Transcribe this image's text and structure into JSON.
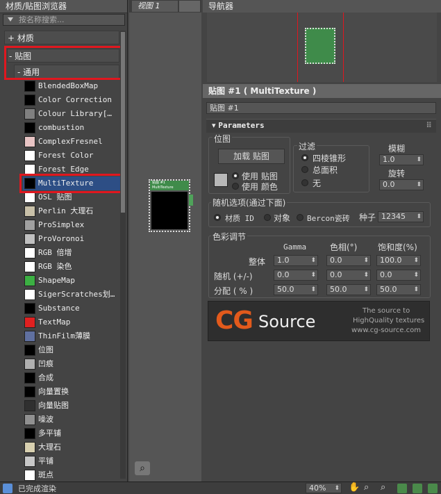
{
  "browser": {
    "title": "材质/贴图浏览器",
    "search_placeholder": "按名称搜索...",
    "groups": {
      "materials": "+ 材质",
      "maps": "- 贴图",
      "general": "- 通用"
    },
    "items": [
      {
        "label": "BlendedBoxMap",
        "swatch": "#000000"
      },
      {
        "label": "Color Correction",
        "swatch": "#000000"
      },
      {
        "label": "Colour Library[…",
        "swatch": "#808080"
      },
      {
        "label": "combustion",
        "swatch": "#000000"
      },
      {
        "label": "ComplexFresnel",
        "swatch": "#e8c4c4"
      },
      {
        "label": "Forest Color",
        "swatch": "#ffffff"
      },
      {
        "label": "Forest Edge",
        "swatch": "#ffffff"
      },
      {
        "label": "MultiTexture",
        "swatch": "#000000"
      },
      {
        "label": "OSL 贴图",
        "swatch": "#ffffff"
      },
      {
        "label": "Perlin 大理石",
        "swatch": "#c8c0a8"
      },
      {
        "label": "ProSimplex",
        "swatch": "#a0a0a0"
      },
      {
        "label": "ProVoronoi",
        "swatch": "#c0c0c0"
      },
      {
        "label": "RGB 倍增",
        "swatch": "#ffffff"
      },
      {
        "label": "RGB 染色",
        "swatch": "#ffffff"
      },
      {
        "label": "ShapeMap",
        "swatch": "#3cb043"
      },
      {
        "label": "SigerScratches划…",
        "swatch": "#ffffff"
      },
      {
        "label": "Substance",
        "swatch": "#000000"
      },
      {
        "label": "TextMap",
        "swatch": "#e02020"
      },
      {
        "label": "ThinFilm薄膜",
        "swatch": "#6070a0"
      },
      {
        "label": "位图",
        "swatch": "#000000"
      },
      {
        "label": "凹痕",
        "swatch": "#b0b0b0"
      },
      {
        "label": "合成",
        "swatch": "#000000"
      },
      {
        "label": "向量置换",
        "swatch": "#000000"
      },
      {
        "label": "向量贴图",
        "swatch": "#303030"
      },
      {
        "label": "噪波",
        "swatch": "#909090"
      },
      {
        "label": "多平铺",
        "swatch": "#000000"
      },
      {
        "label": "大理石",
        "swatch": "#d8d0b0"
      },
      {
        "label": "平铺",
        "swatch": "#c8c8c8"
      },
      {
        "label": "斑点",
        "swatch": "#ffffff"
      }
    ],
    "selected_index": 7
  },
  "view": {
    "tab_label": "视图 1",
    "node_title": "贴图 #1",
    "node_subtitle": "MultiTexture"
  },
  "navigator": {
    "title": "导航器"
  },
  "properties": {
    "title": "贴图 #1 ( MultiTexture )",
    "name_value": "贴图 #1",
    "rollout": "Parameters",
    "bitmap_group": "位图",
    "load_map_button": "加载 贴图",
    "use_map": "使用 贴图",
    "use_color": "使用 颜色",
    "filter_group": "过滤",
    "filter_options": [
      "四棱锥形",
      "总面积",
      "无"
    ],
    "blur_label": "模糊",
    "blur_value": "1.0",
    "rotate_label": "旋转",
    "rotate_value": "0.0",
    "random_group": "随机选项(通过下面)",
    "random_options": [
      "材质 ID",
      "对象",
      "Bercon瓷砖"
    ],
    "seed_label": "种子",
    "seed_value": "12345",
    "color_group": "色彩调节",
    "col_headers": [
      "Gamma",
      "色相(°)",
      "饱和度(%)"
    ],
    "rows": [
      {
        "label": "整体",
        "values": [
          "1.0",
          "0.0",
          "100.0"
        ]
      },
      {
        "label": "随机 (+/-)",
        "values": [
          "0.0",
          "0.0",
          "0.0"
        ]
      },
      {
        "label": "分配 ( % )",
        "values": [
          "50.0",
          "50.0",
          "50.0"
        ]
      }
    ],
    "banner": {
      "cg": "CG",
      "source": "Source",
      "tag1": "The source to",
      "tag2": "HighQuality textures",
      "tag3": "www.cg-source.com"
    }
  },
  "status": {
    "text": "已完成渲染",
    "zoom": "40%"
  },
  "colors": {
    "accent_red": "#e0171f",
    "selection": "#2d4e85",
    "node_green": "#3f8b4a"
  }
}
